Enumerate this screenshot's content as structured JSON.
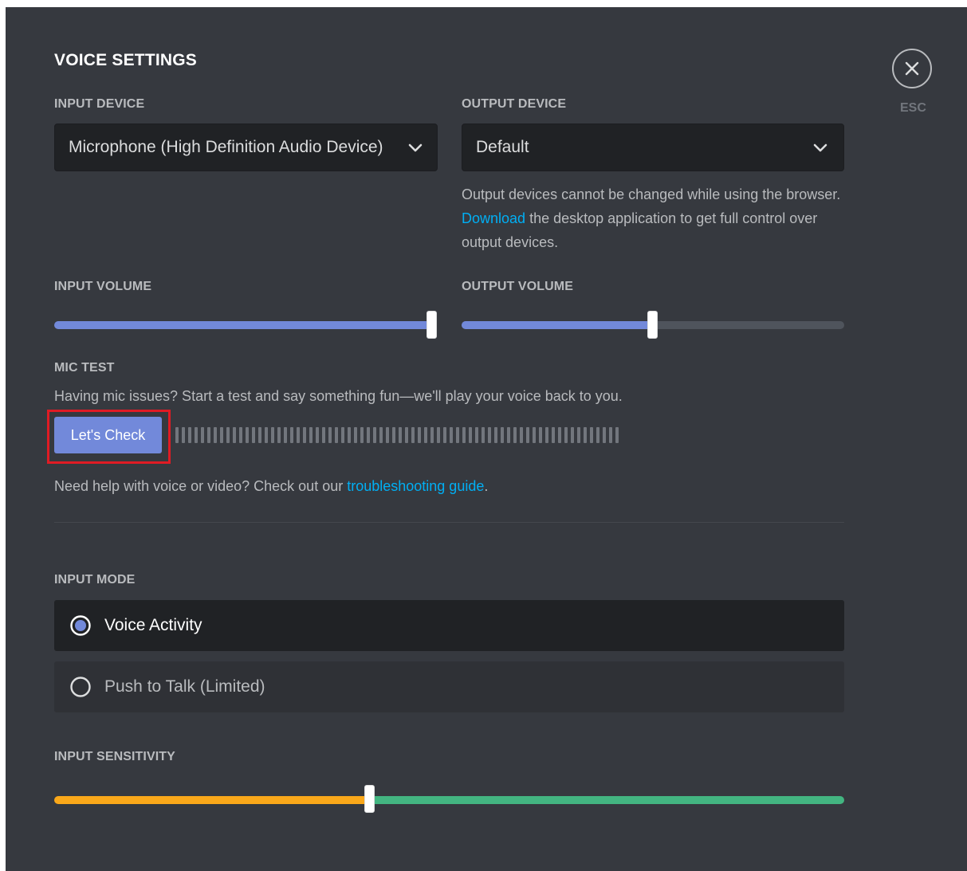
{
  "header": {
    "title": "VOICE SETTINGS",
    "close_label": "ESC"
  },
  "devices": {
    "input_label": "INPUT DEVICE",
    "input_value": "Microphone (High Definition Audio Device)",
    "output_label": "OUTPUT DEVICE",
    "output_value": "Default",
    "output_note_before": "Output devices cannot be changed while using the browser. ",
    "output_note_link": "Download",
    "output_note_after": " the desktop application to get full control over output devices."
  },
  "volume": {
    "input_label": "INPUT VOLUME",
    "input_level": 100,
    "output_label": "OUTPUT VOLUME",
    "output_level": 50
  },
  "mic_test": {
    "label": "MIC TEST",
    "description": "Having mic issues? Start a test and say something fun—we'll play your voice back to you.",
    "button_label": "Let's Check",
    "meter_bars": 70
  },
  "help": {
    "text_before": "Need help with voice or video? Check out our ",
    "link": "troubleshooting guide",
    "text_after": "."
  },
  "input_mode": {
    "label": "INPUT MODE",
    "options": [
      {
        "label": "Voice Activity",
        "selected": true
      },
      {
        "label": "Push to Talk (Limited)",
        "selected": false
      }
    ]
  },
  "sensitivity": {
    "label": "INPUT SENSITIVITY",
    "threshold_percent": 40
  },
  "colors": {
    "background": "#36393f",
    "accent": "#7289da",
    "link": "#00aff4",
    "sensitivity_low": "#faa81a",
    "sensitivity_high": "#43b581",
    "highlight": "#e01b24"
  }
}
